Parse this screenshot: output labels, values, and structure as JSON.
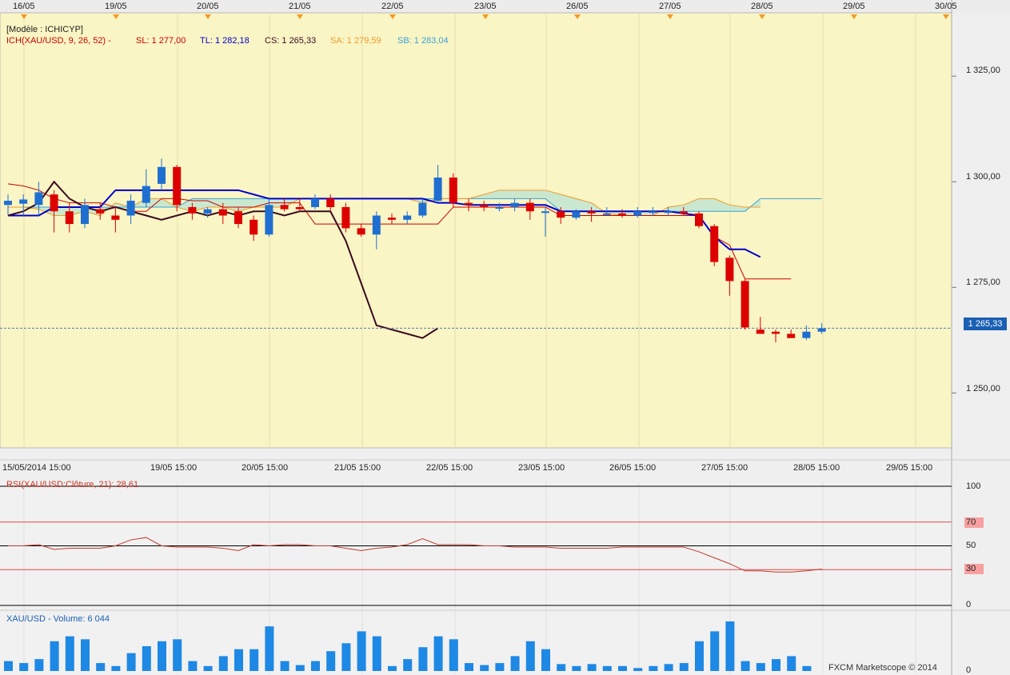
{
  "top_dates": [
    "16/05",
    "19/05",
    "20/05",
    "21/05",
    "22/05",
    "23/05",
    "26/05",
    "27/05",
    "28/05",
    "29/05",
    "30/05"
  ],
  "x_labels": [
    "15/05/2014 15:00",
    "19/05 15:00",
    "20/05 15:00",
    "21/05 15:00",
    "22/05 15:00",
    "23/05 15:00",
    "26/05 15:00",
    "27/05 15:00",
    "28/05 15:00",
    "29/05 15:00"
  ],
  "legend": {
    "model": "[Modèle : ICHICYP]",
    "ich": "ICH(XAU/USD, 9, 26, 52) -",
    "sl": "SL: 1 277,00",
    "tl": "TL: 1 282,18",
    "cs": "CS: 1 265,33",
    "sa": "SA: 1 279,59",
    "sb": "SB: 1 283,04"
  },
  "price_axis": [
    "1 325,00",
    "1 300,00",
    "1 275,00",
    "1 250,00"
  ],
  "last_price": "1 265,33",
  "rsi": {
    "title": "RSI(XAU/USD:Clôture, 21): 28,61",
    "levels": [
      "100",
      "70",
      "50",
      "30",
      "0"
    ]
  },
  "volume": {
    "title": "XAU/USD - Volume: 6 044",
    "zero_label": "0"
  },
  "watermark": "FXCM Marketscope © 2014",
  "colors": {
    "plot_bg": "#faf5c4",
    "up": "#1f6fd1",
    "down": "#dd0000",
    "tenkan": "#0000cc",
    "kijun": "#cc0000",
    "chikou": "#3a0a22",
    "senkou_a": "#f09a2c",
    "senkou_b": "#3aa0d8",
    "cloud": "#b9e3d3",
    "rsi_line": "#c0392b",
    "volume_bar": "#1e88e5"
  },
  "chart_data": {
    "type": "candlestick",
    "symbol": "XAU/USD",
    "ylim": [
      1237,
      1340
    ],
    "candles": [
      {
        "o": 1294.5,
        "h": 1297,
        "l": 1292,
        "c": 1295.5
      },
      {
        "o": 1294.8,
        "h": 1297,
        "l": 1292,
        "c": 1295.8
      },
      {
        "o": 1294.5,
        "h": 1300,
        "l": 1292,
        "c": 1297.5
      },
      {
        "o": 1297,
        "h": 1298,
        "l": 1288,
        "c": 1293
      },
      {
        "o": 1293,
        "h": 1295,
        "l": 1288,
        "c": 1290
      },
      {
        "o": 1290,
        "h": 1296,
        "l": 1289,
        "c": 1294.5
      },
      {
        "o": 1293.5,
        "h": 1295,
        "l": 1291,
        "c": 1292.5
      },
      {
        "o": 1292,
        "h": 1294,
        "l": 1288,
        "c": 1291
      },
      {
        "o": 1292,
        "h": 1297,
        "l": 1290,
        "c": 1295.5
      },
      {
        "o": 1295,
        "h": 1303,
        "l": 1294,
        "c": 1299
      },
      {
        "o": 1299.5,
        "h": 1305.5,
        "l": 1298,
        "c": 1303.5
      },
      {
        "o": 1303.5,
        "h": 1304,
        "l": 1293,
        "c": 1294.5
      },
      {
        "o": 1294,
        "h": 1295,
        "l": 1291,
        "c": 1292.5
      },
      {
        "o": 1292.5,
        "h": 1294,
        "l": 1291.5,
        "c": 1293.5
      },
      {
        "o": 1293.5,
        "h": 1295,
        "l": 1290,
        "c": 1292
      },
      {
        "o": 1293,
        "h": 1294,
        "l": 1289,
        "c": 1290
      },
      {
        "o": 1291,
        "h": 1292,
        "l": 1286,
        "c": 1287.5
      },
      {
        "o": 1287.5,
        "h": 1296,
        "l": 1287,
        "c": 1294.5
      },
      {
        "o": 1294.5,
        "h": 1296,
        "l": 1293,
        "c": 1293.5
      },
      {
        "o": 1294,
        "h": 1296,
        "l": 1293,
        "c": 1293.5
      },
      {
        "o": 1294,
        "h": 1297,
        "l": 1293.5,
        "c": 1296
      },
      {
        "o": 1296,
        "h": 1297,
        "l": 1293,
        "c": 1294
      },
      {
        "o": 1294,
        "h": 1295,
        "l": 1288,
        "c": 1289
      },
      {
        "o": 1289,
        "h": 1290,
        "l": 1287,
        "c": 1287.5
      },
      {
        "o": 1287.5,
        "h": 1293,
        "l": 1284,
        "c": 1292
      },
      {
        "o": 1291.5,
        "h": 1292.5,
        "l": 1290,
        "c": 1291
      },
      {
        "o": 1291,
        "h": 1293,
        "l": 1290,
        "c": 1292
      },
      {
        "o": 1292,
        "h": 1296,
        "l": 1291.5,
        "c": 1295
      },
      {
        "o": 1295.5,
        "h": 1304,
        "l": 1295,
        "c": 1301
      },
      {
        "o": 1301,
        "h": 1302,
        "l": 1294,
        "c": 1295
      },
      {
        "o": 1295,
        "h": 1296,
        "l": 1293,
        "c": 1294.5
      },
      {
        "o": 1294.5,
        "h": 1295.5,
        "l": 1293,
        "c": 1294
      },
      {
        "o": 1294,
        "h": 1295,
        "l": 1293,
        "c": 1294
      },
      {
        "o": 1294,
        "h": 1296,
        "l": 1293,
        "c": 1295
      },
      {
        "o": 1295,
        "h": 1296,
        "l": 1291,
        "c": 1293
      },
      {
        "o": 1293,
        "h": 1294,
        "l": 1287,
        "c": 1293
      },
      {
        "o": 1293,
        "h": 1294,
        "l": 1290,
        "c": 1291.5
      },
      {
        "o": 1291.5,
        "h": 1293.5,
        "l": 1291,
        "c": 1293
      },
      {
        "o": 1293,
        "h": 1294,
        "l": 1290.5,
        "c": 1292.5
      },
      {
        "o": 1292.5,
        "h": 1294,
        "l": 1292,
        "c": 1292.5
      },
      {
        "o": 1292.5,
        "h": 1293.5,
        "l": 1291.5,
        "c": 1292
      },
      {
        "o": 1292,
        "h": 1294,
        "l": 1291.5,
        "c": 1293
      },
      {
        "o": 1293,
        "h": 1294,
        "l": 1292,
        "c": 1293
      },
      {
        "o": 1293,
        "h": 1294,
        "l": 1292,
        "c": 1293
      },
      {
        "o": 1293,
        "h": 1294,
        "l": 1292,
        "c": 1292.5
      },
      {
        "o": 1292.5,
        "h": 1293,
        "l": 1289,
        "c": 1289.5
      },
      {
        "o": 1289.5,
        "h": 1290,
        "l": 1280,
        "c": 1281
      },
      {
        "o": 1282,
        "h": 1282.5,
        "l": 1273,
        "c": 1276.5
      },
      {
        "o": 1276.5,
        "h": 1277,
        "l": 1265,
        "c": 1265.5
      },
      {
        "o": 1265,
        "h": 1268,
        "l": 1264,
        "c": 1264
      },
      {
        "o": 1264.5,
        "h": 1265,
        "l": 1262,
        "c": 1264
      },
      {
        "o": 1264,
        "h": 1265,
        "l": 1263,
        "c": 1263
      },
      {
        "o": 1263,
        "h": 1266,
        "l": 1262.5,
        "c": 1264.5
      },
      {
        "o": 1264.5,
        "h": 1266.5,
        "l": 1264,
        "c": 1265.3
      }
    ],
    "tenkan": [
      1292,
      1292,
      1292,
      1294,
      1294,
      1294,
      1294,
      1298,
      1298,
      1298,
      1298,
      1298,
      1298,
      1298,
      1298,
      1298,
      1297,
      1296,
      1296,
      1296,
      1296,
      1296,
      1296,
      1296,
      1296,
      1296,
      1296,
      1296,
      1295,
      1295,
      1294.5,
      1294.5,
      1294.5,
      1294.5,
      1294.5,
      1294.5,
      1293,
      1293,
      1293,
      1293,
      1293,
      1293,
      1293,
      1293,
      1292.5,
      1292,
      1287,
      1284,
      1284,
      1282.18
    ],
    "kijun": [
      1299.5,
      1299,
      1298,
      1296,
      1295,
      1295,
      1295,
      1294,
      1293,
      1293,
      1296,
      1296,
      1295.5,
      1295.5,
      1294,
      1294,
      1294,
      1295,
      1295,
      1295,
      1290,
      1290,
      1290,
      1290,
      1290,
      1290,
      1290,
      1290,
      1290,
      1294,
      1294,
      1294,
      1294,
      1294,
      1294,
      1294,
      1292,
      1292,
      1292,
      1292,
      1292,
      1292,
      1292,
      1292,
      1292,
      1292,
      1287,
      1285,
      1277,
      1277,
      1277,
      1277
    ],
    "chikou": [
      1292,
      1293,
      1295,
      1300,
      1296,
      1294,
      1293,
      1294,
      1293,
      1292,
      1291,
      1292,
      1293,
      1292,
      1293,
      1292,
      1293,
      1293,
      1292,
      1293,
      1293,
      1293,
      1286,
      1276,
      1266,
      1265,
      1264,
      1263,
      1265.33
    ],
    "senkou_a": [
      1294,
      1294,
      1293.5,
      1292,
      1292,
      1293,
      1292,
      1295,
      1294,
      1296,
      1296,
      1294,
      1293,
      1294,
      1294,
      1293,
      1294,
      1294,
      1294,
      1296,
      1296,
      1296,
      1296,
      1296,
      1296,
      1296,
      1296,
      1295,
      1296,
      1296,
      1296,
      1297,
      1298,
      1298,
      1298,
      1298,
      1297,
      1296,
      1295,
      1292.5,
      1292,
      1292,
      1292,
      1294,
      1294.5,
      1296,
      1296,
      1294.5,
      1294,
      1294
    ],
    "senkou_b": [
      1294,
      1294,
      1294,
      1294,
      1294,
      1294,
      1294,
      1294,
      1294,
      1294,
      1294,
      1294,
      1296,
      1296,
      1296,
      1296,
      1296,
      1296,
      1296,
      1296,
      1296,
      1296,
      1296,
      1296,
      1296,
      1296,
      1296,
      1296,
      1296,
      1296,
      1296,
      1296,
      1296,
      1296,
      1296,
      1296,
      1293,
      1293,
      1293,
      1293,
      1293,
      1293,
      1293,
      1293,
      1293,
      1293,
      1293,
      1293,
      1293,
      1296,
      1296,
      1296,
      1296,
      1296
    ],
    "rsi": [
      50,
      50,
      51,
      47,
      48,
      48,
      48,
      50,
      55,
      57,
      50,
      49,
      49,
      49,
      48,
      46,
      51,
      50,
      51,
      51,
      50,
      50,
      48,
      46,
      48,
      49,
      51,
      56,
      51,
      51,
      51,
      50,
      50,
      49,
      49,
      49,
      48,
      48,
      48,
      48,
      49,
      49,
      49,
      49,
      49,
      45,
      40,
      35,
      29,
      29,
      28,
      28,
      29,
      30.5
    ],
    "volume": [
      10,
      8,
      12,
      30,
      35,
      32,
      8,
      5,
      18,
      25,
      30,
      32,
      10,
      5,
      15,
      22,
      22,
      45,
      10,
      6,
      10,
      20,
      28,
      40,
      35,
      5,
      12,
      24,
      35,
      32,
      8,
      6,
      8,
      15,
      30,
      22,
      7,
      5,
      7,
      5,
      5,
      3,
      5,
      7,
      8,
      30,
      40,
      50,
      10,
      8,
      12,
      15,
      5
    ]
  }
}
